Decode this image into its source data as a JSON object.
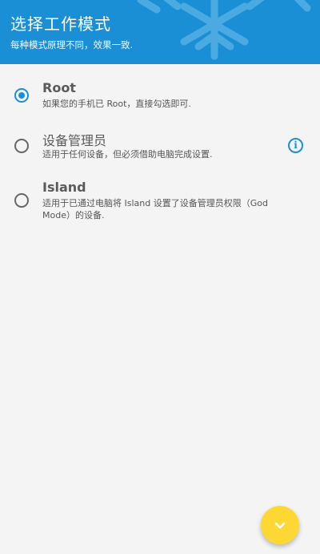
{
  "header": {
    "title": "选择工作模式",
    "subtitle": "每种模式原理不同，效果一致."
  },
  "options": [
    {
      "title": "Root",
      "description": "如果您的手机已 Root，直接勾选即可.",
      "selected": true,
      "has_info": false
    },
    {
      "title": "设备管理员",
      "description": "适用于任何设备，但必须借助电脑完成设置.",
      "selected": false,
      "has_info": true
    },
    {
      "title": "Island",
      "description": "适用于已通过电脑将 Island 设置了设备管理员权限（God Mode）的设备.",
      "selected": false,
      "has_info": false
    }
  ],
  "icons": {
    "info": "info-icon",
    "fab": "chevron-down-icon",
    "header_decor": "snowflake-icon"
  },
  "colors": {
    "primary": "#1a8fd6",
    "fab": "#fdd835",
    "background": "#f4f4f4"
  }
}
